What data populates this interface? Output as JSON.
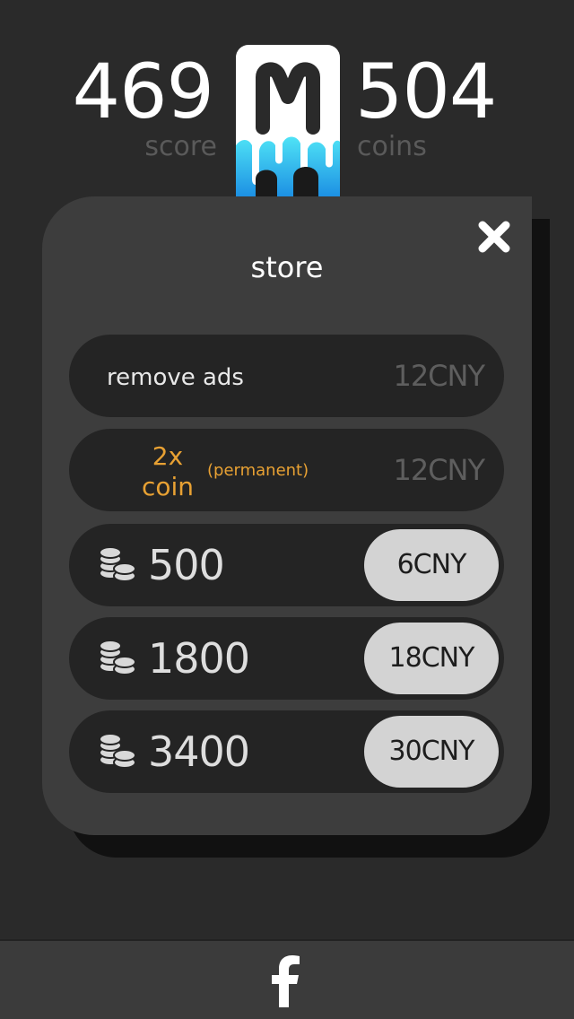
{
  "header": {
    "score_value": "469",
    "score_label": "score",
    "coins_value": "504",
    "coins_label": "coins",
    "logo_letter": "M"
  },
  "store": {
    "title": "store",
    "close_icon": "close-icon",
    "remove_ads": {
      "label": "remove ads",
      "price": "12CNY"
    },
    "double_coin": {
      "line1": "2x",
      "line2": "coin",
      "note": "(permanent)",
      "price": "12CNY"
    },
    "coin_packs": [
      {
        "amount": "500",
        "price": "6CNY",
        "icon": "coin-stack-icon"
      },
      {
        "amount": "1800",
        "price": "18CNY",
        "icon": "coin-stack-icon"
      },
      {
        "amount": "3400",
        "price": "30CNY",
        "icon": "coin-stack-icon"
      }
    ]
  },
  "footer": {
    "share_icon": "facebook-icon"
  },
  "colors": {
    "background": "#2a2a2a",
    "panel": "#3d3d3d",
    "row": "#242424",
    "accent_orange": "#e8a133",
    "logo_cyan": "#36d4f0",
    "button": "#d3d3d3"
  }
}
